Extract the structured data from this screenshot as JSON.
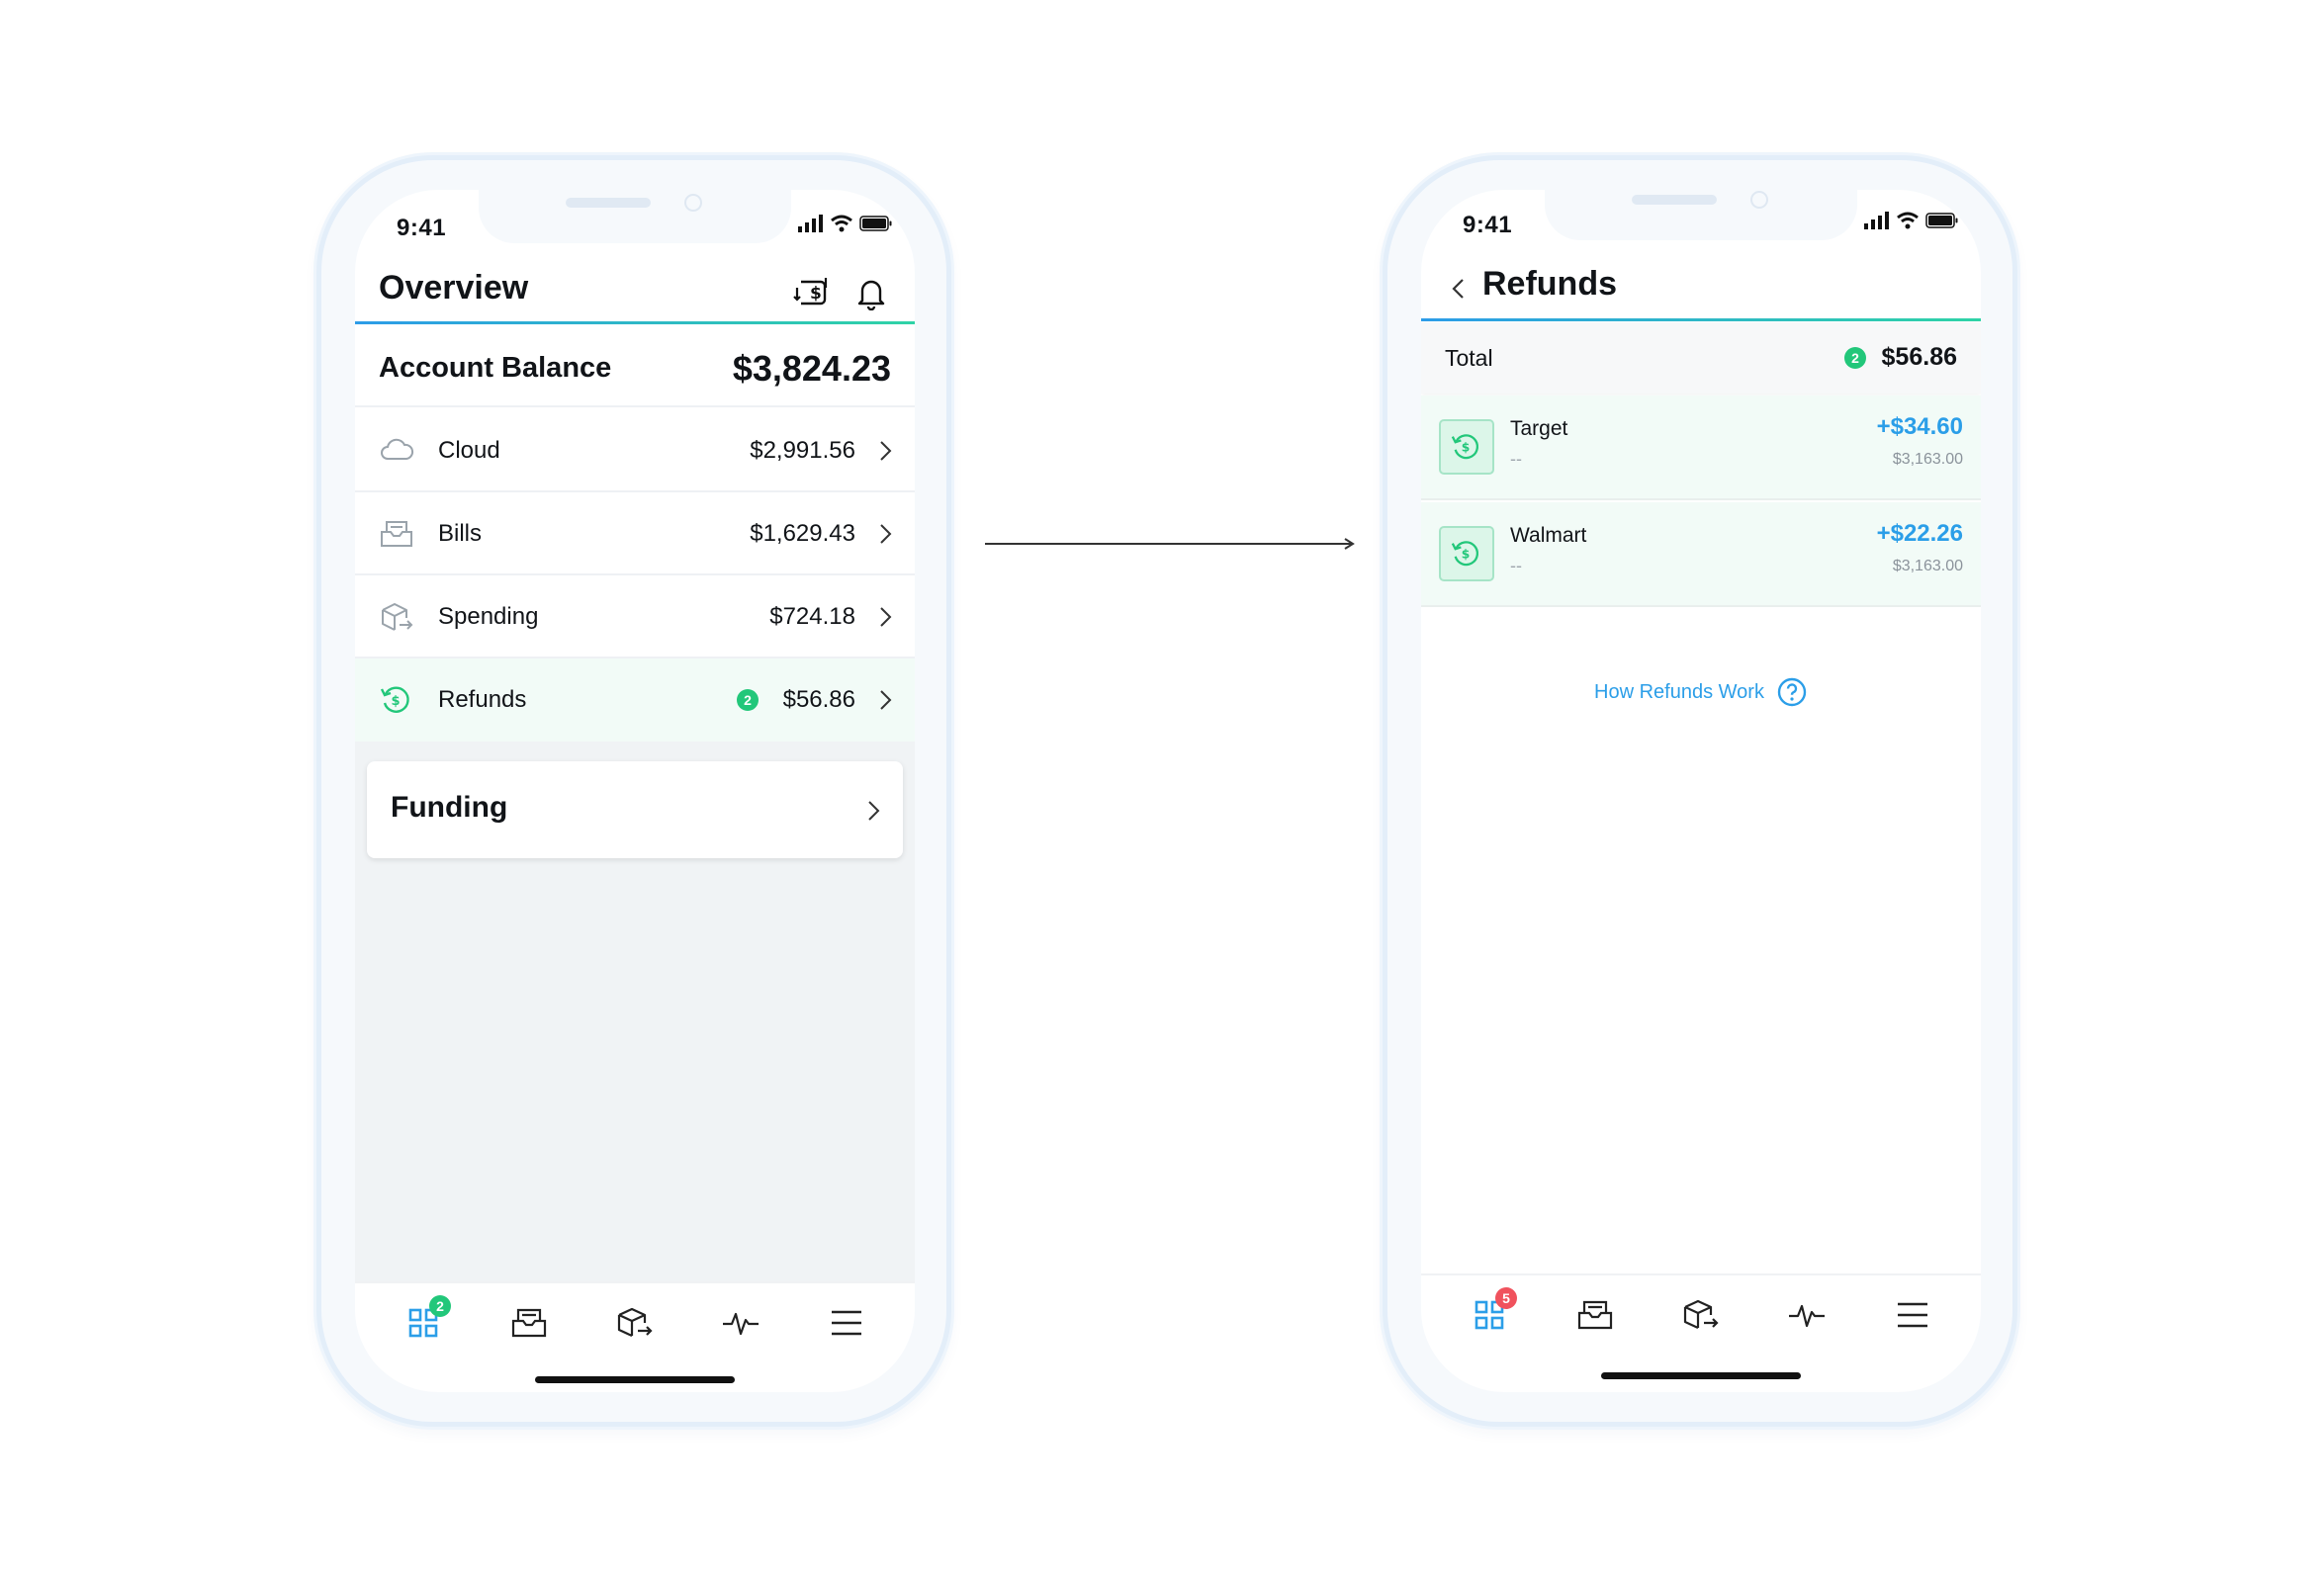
{
  "colors": {
    "accent_blue": "#2b9ee8",
    "accent_green": "#22c77a",
    "badge_red": "#f0525d",
    "highlight_bg": "#f2fbf7"
  },
  "left_screen": {
    "status": {
      "time": "9:41"
    },
    "header": {
      "title": "Overview",
      "icons": [
        "currency-exchange-icon",
        "bell-icon"
      ]
    },
    "balance": {
      "label": "Account Balance",
      "value": "$3,824.23"
    },
    "accounts": [
      {
        "label": "Cloud",
        "value": "$2,991.56",
        "icon": "cloud-icon"
      },
      {
        "label": "Bills",
        "value": "$1,629.43",
        "icon": "inbox-icon"
      },
      {
        "label": "Spending",
        "value": "$724.18",
        "icon": "box-arrow-icon"
      },
      {
        "label": "Refunds",
        "value": "$56.86",
        "icon": "refund-icon",
        "badge": "2"
      }
    ],
    "funding": {
      "label": "Funding"
    },
    "tabbar": {
      "badge": "2",
      "icons": [
        "dashboard-icon",
        "inbox-icon",
        "box-arrow-icon",
        "activity-icon",
        "menu-icon"
      ]
    }
  },
  "right_screen": {
    "status": {
      "time": "9:41"
    },
    "header": {
      "title": "Refunds"
    },
    "total": {
      "label": "Total",
      "badge": "2",
      "value": "$56.86"
    },
    "refunds": [
      {
        "name": "Target",
        "sub": "--",
        "amount": "+$34.60",
        "balance": "$3,163.00"
      },
      {
        "name": "Walmart",
        "sub": "--",
        "amount": "+$22.26",
        "balance": "$3,163.00"
      }
    ],
    "help_link": "How Refunds Work",
    "tabbar": {
      "badge": "5",
      "icons": [
        "dashboard-icon",
        "inbox-icon",
        "box-arrow-icon",
        "activity-icon",
        "menu-icon"
      ]
    }
  }
}
